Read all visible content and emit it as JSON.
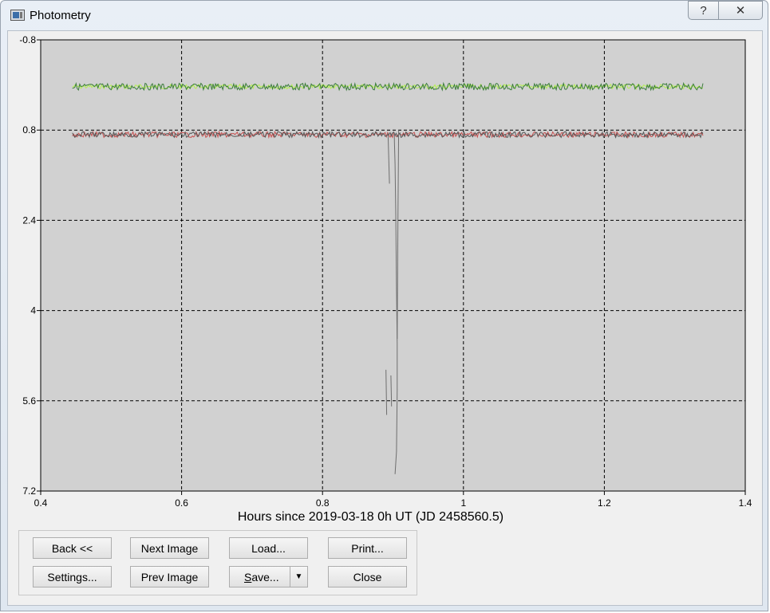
{
  "window": {
    "title": "Photometry",
    "help_label": "?",
    "close_label": "✕",
    "icon": "photometry-app-icon"
  },
  "chart_data": {
    "type": "line",
    "xlabel": "Hours since 2019-03-18 0h UT (JD 2458560.5)",
    "ylabel": "",
    "xlim": [
      0.4,
      1.4
    ],
    "ylim": [
      7.2,
      -0.8
    ],
    "y_inverted": true,
    "grid": true,
    "xticks": [
      "0.4",
      "0.6",
      "0.8",
      "1",
      "1.2",
      "1.4"
    ],
    "yticks": [
      "-0.8",
      "0.8",
      "2.4",
      "4",
      "5.6",
      "7.2"
    ],
    "background": "#d1d1d1",
    "series": [
      {
        "color": "#b4f050",
        "x_range": [
          0.445,
          1.34
        ],
        "y_mean": 0.03,
        "noise": 0.04
      },
      {
        "color": "#3c7d3c",
        "x_range": [
          0.445,
          1.34
        ],
        "y_mean": 0.03,
        "noise": 0.06
      },
      {
        "color": "#c85050",
        "x_range": [
          0.445,
          1.34
        ],
        "y_mean": 0.88,
        "noise": 0.05
      },
      {
        "color": "#555555",
        "x_range": [
          0.445,
          1.34
        ],
        "y_mean": 0.88,
        "noise": 0.05
      }
    ],
    "dropouts": {
      "color": "#6e6e6e",
      "segments": [
        [
          [
            0.893,
            0.85
          ],
          [
            0.895,
            1.75
          ]
        ],
        [
          [
            0.89,
            5.05
          ],
          [
            0.891,
            5.85
          ]
        ],
        [
          [
            0.897,
            5.15
          ],
          [
            0.898,
            5.7
          ]
        ],
        [
          [
            0.902,
            0.85
          ],
          [
            0.902,
            1.0
          ],
          [
            0.903,
            1.4
          ],
          [
            0.904,
            2.3
          ],
          [
            0.905,
            3.6
          ],
          [
            0.906,
            4.6
          ],
          [
            0.906,
            5.4
          ],
          [
            0.905,
            6.5
          ],
          [
            0.903,
            6.9
          ]
        ],
        [
          [
            0.908,
            0.8
          ],
          [
            0.907,
            2.4
          ],
          [
            0.906,
            4.5
          ]
        ]
      ]
    }
  },
  "buttons": {
    "back": "Back <<",
    "next_image": "Next Image",
    "load": "Load...",
    "print": "Print...",
    "settings": "Settings...",
    "prev_image": "Prev Image",
    "save_u": "S",
    "save_rest": "ave...",
    "save_arrow": "▼",
    "close": "Close"
  }
}
